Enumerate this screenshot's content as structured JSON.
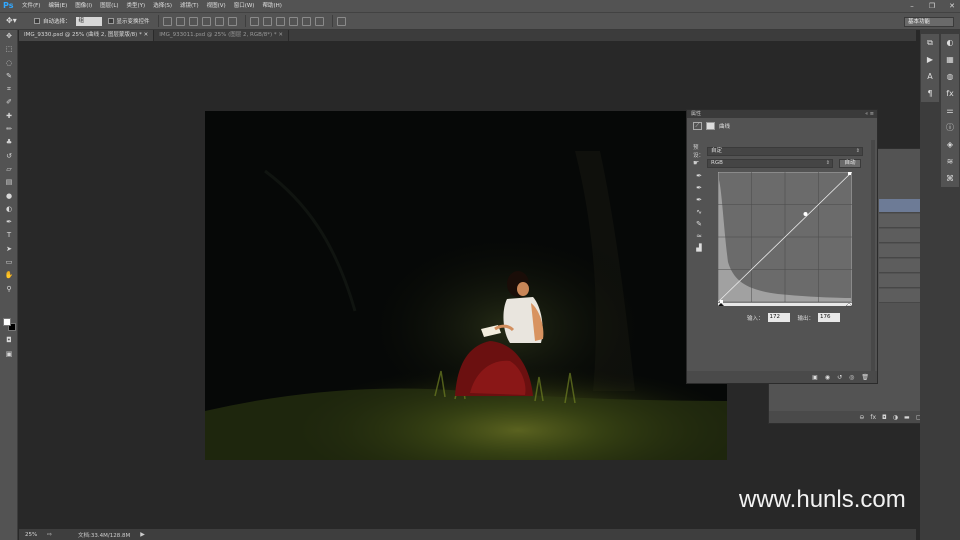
{
  "app": {
    "logo": "Ps"
  },
  "menu": [
    "文件(F)",
    "编辑(E)",
    "图像(I)",
    "图层(L)",
    "类型(Y)",
    "选择(S)",
    "滤镜(T)",
    "视图(V)",
    "窗口(W)",
    "帮助(H)"
  ],
  "options": {
    "auto_select_label": "自动选择：",
    "auto_select_value": "组",
    "show_transform_label": "显示变换控件",
    "workspace": "基本功能"
  },
  "tabs": [
    {
      "label": "IMG_9330.psd @ 25% (曲线 2, 图层蒙版/8) *",
      "active": true
    },
    {
      "label": "IMG_933011.psd @ 25% (图层 2, RGB/8*) *",
      "active": false
    }
  ],
  "properties": {
    "header": "属性",
    "panel_title": "曲线",
    "preset_label": "预设：",
    "preset_value": "自定",
    "channel_value": "RGB",
    "auto_button": "自动",
    "input_label": "输入：",
    "input_value": "172",
    "output_label": "输出：",
    "output_value": "176"
  },
  "status": {
    "zoom": "25%",
    "doc_info": "文档:33.4M/128.8M"
  },
  "watermark": "www.hunls.com",
  "colors": {
    "accent": "#31a8ff",
    "selected_layer": "#6d7b96",
    "foreground": "#ffffff",
    "background": "#000000"
  },
  "tools": [
    "move-tool",
    "marquee-tool",
    "lasso-tool",
    "quick-select-tool",
    "crop-tool",
    "eyedropper-tool",
    "healing-tool",
    "brush-tool",
    "clone-stamp-tool",
    "history-brush-tool",
    "eraser-tool",
    "gradient-tool",
    "blur-tool",
    "dodge-tool",
    "pen-tool",
    "type-tool",
    "path-select-tool",
    "rectangle-tool",
    "hand-tool",
    "zoom-tool"
  ]
}
